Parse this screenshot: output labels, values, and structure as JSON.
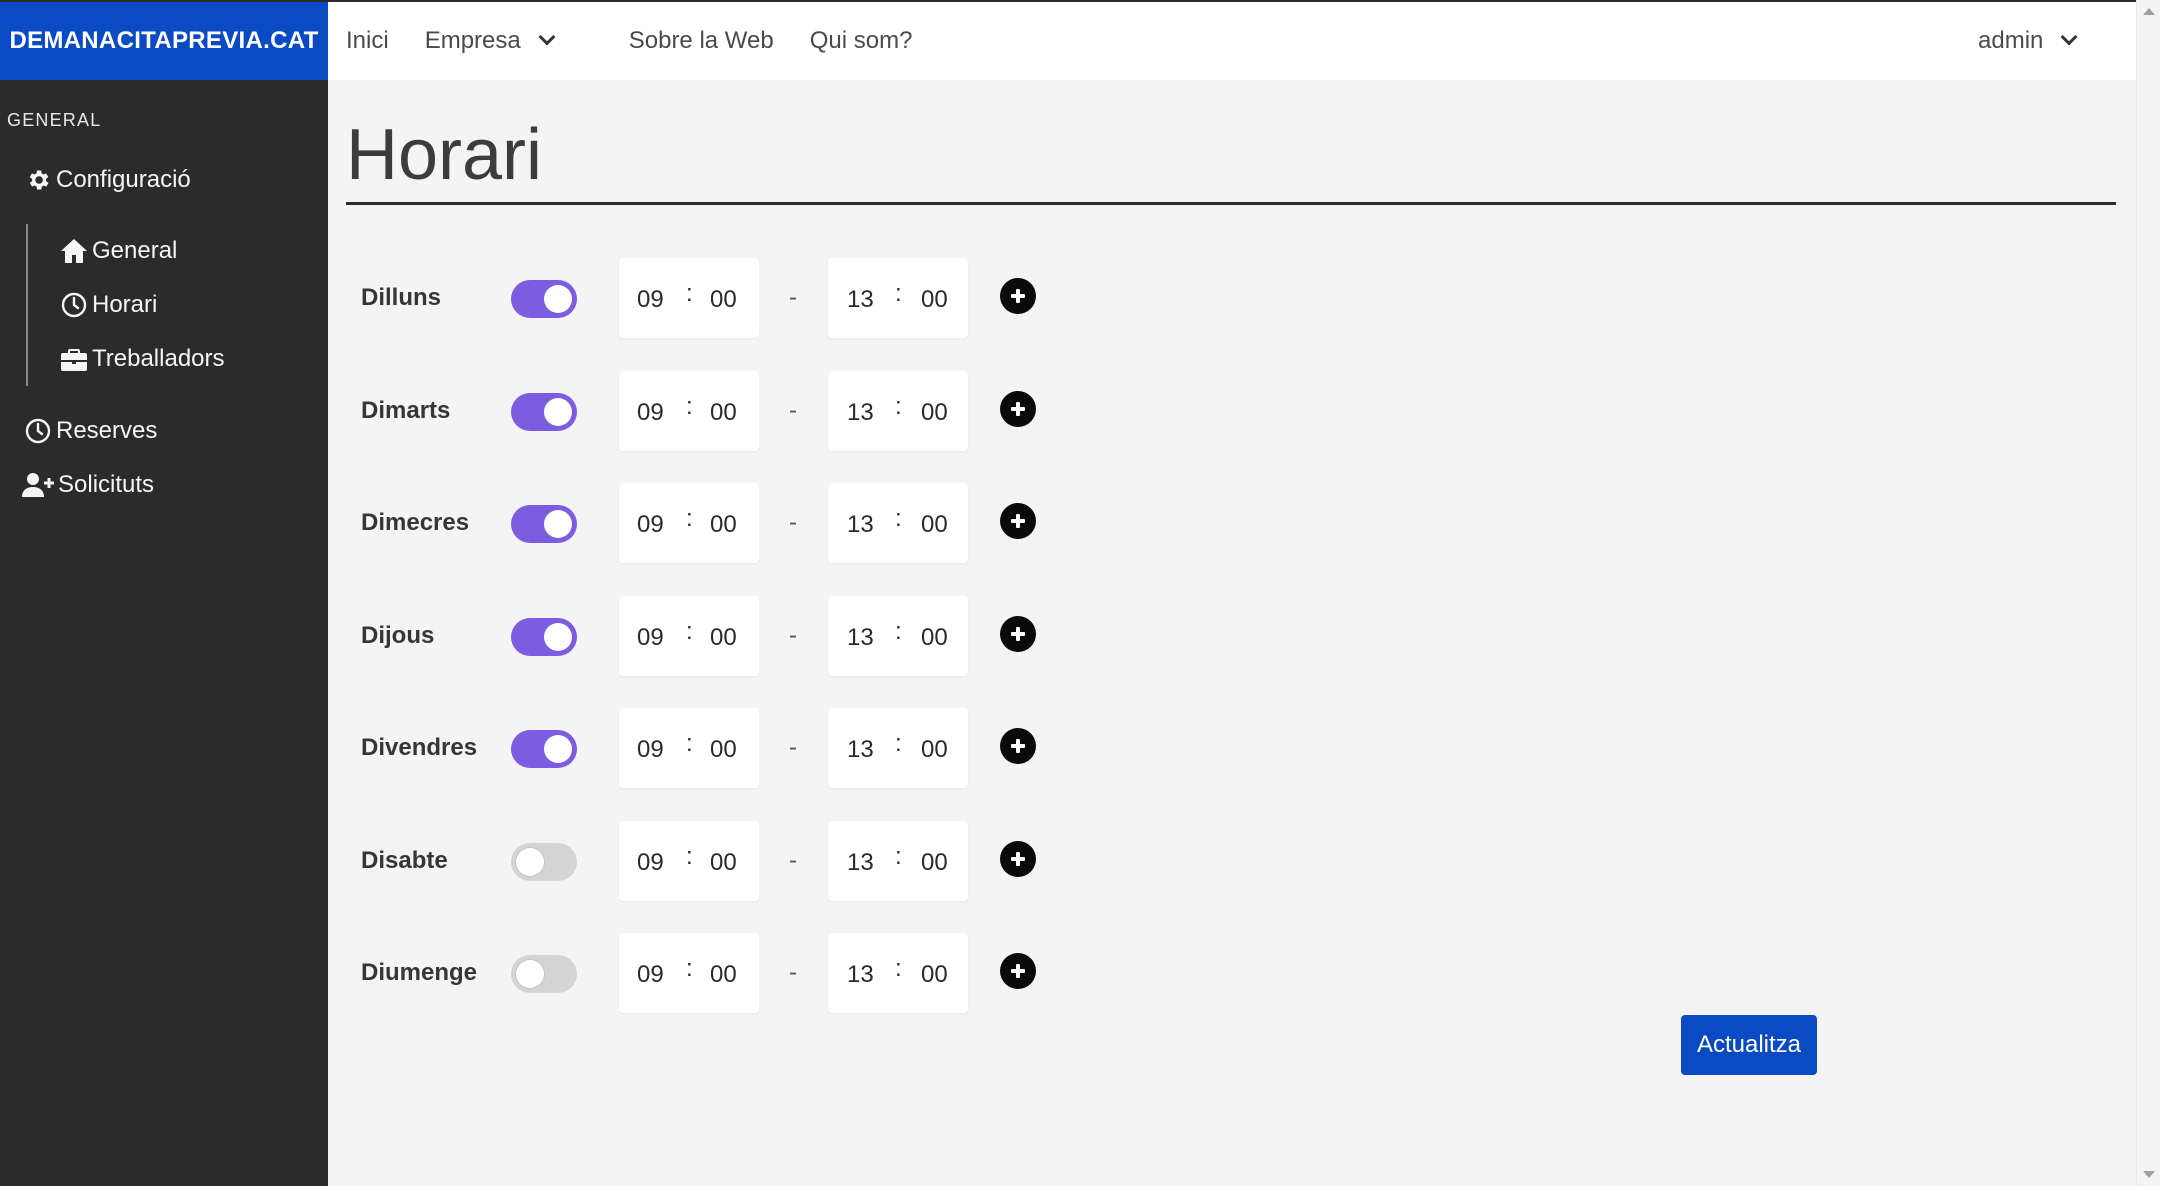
{
  "app": {
    "brand": "DEMANACITAPREVIA.CAT",
    "accent_color": "#0a4bc4",
    "toggle_on_color": "#7c5ce0"
  },
  "topnav": {
    "home": "Inici",
    "company": "Empresa",
    "about_web": "Sobre la Web",
    "who_we_are": "Qui som?",
    "user": "admin"
  },
  "sidebar": {
    "section_label": "GENERAL",
    "config": {
      "label": "Configuració",
      "icon": "gear-icon"
    },
    "sub": [
      {
        "label": "General",
        "icon": "home-icon"
      },
      {
        "label": "Horari",
        "icon": "clock-icon"
      },
      {
        "label": "Treballadors",
        "icon": "briefcase-icon"
      }
    ],
    "reserves": {
      "label": "Reserves",
      "icon": "clock-icon"
    },
    "requests": {
      "label": "Solicituts",
      "icon": "user-plus-icon"
    }
  },
  "page": {
    "title": "Horari",
    "submit_label": "Actualitza"
  },
  "schedule": [
    {
      "day": "Dilluns",
      "enabled": true,
      "start_h": "09",
      "start_m": "00",
      "end_h": "13",
      "end_m": "00"
    },
    {
      "day": "Dimarts",
      "enabled": true,
      "start_h": "09",
      "start_m": "00",
      "end_h": "13",
      "end_m": "00"
    },
    {
      "day": "Dimecres",
      "enabled": true,
      "start_h": "09",
      "start_m": "00",
      "end_h": "13",
      "end_m": "00"
    },
    {
      "day": "Dijous",
      "enabled": true,
      "start_h": "09",
      "start_m": "00",
      "end_h": "13",
      "end_m": "00"
    },
    {
      "day": "Divendres",
      "enabled": true,
      "start_h": "09",
      "start_m": "00",
      "end_h": "13",
      "end_m": "00"
    },
    {
      "day": "Disabte",
      "enabled": false,
      "start_h": "09",
      "start_m": "00",
      "end_h": "13",
      "end_m": "00"
    },
    {
      "day": "Diumenge",
      "enabled": false,
      "start_h": "09",
      "start_m": "00",
      "end_h": "13",
      "end_m": "00"
    }
  ],
  "separators": {
    "colon": ":",
    "dash": "-"
  }
}
